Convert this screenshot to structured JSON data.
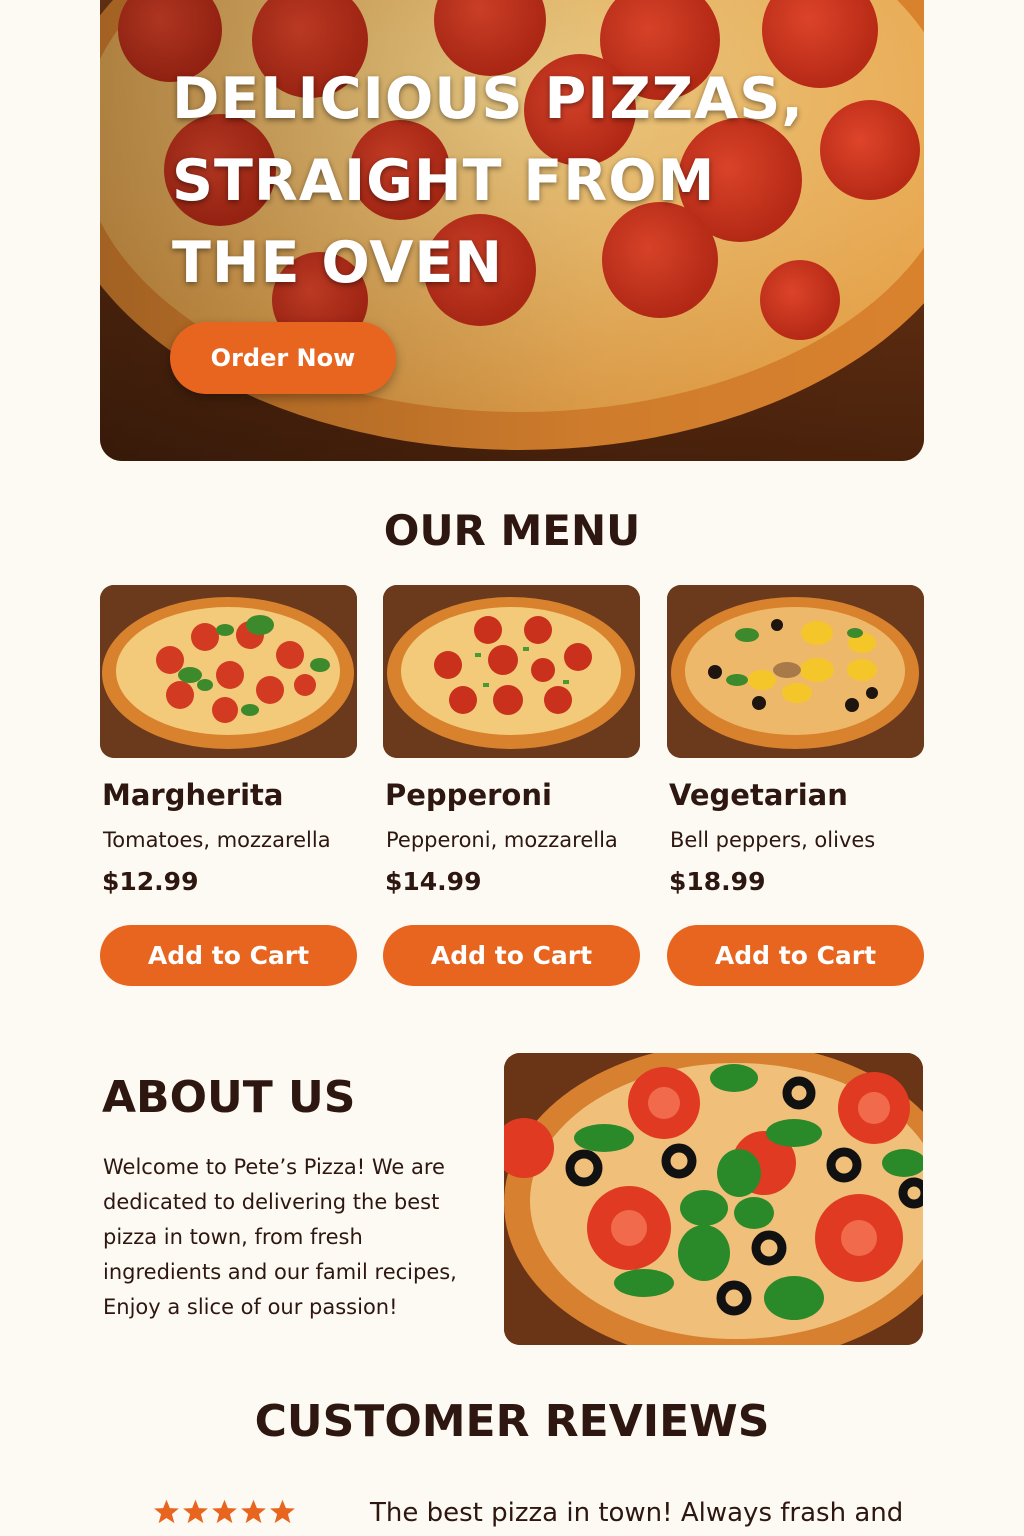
{
  "hero": {
    "title_lines": [
      "DELICIOUS PIZZAS,",
      "STRAIGHT FROM",
      "THE OVEN"
    ],
    "cta_label": "Order Now"
  },
  "menu": {
    "title": "OUR MENU",
    "items": [
      {
        "name": "Margherita",
        "description": "Tomatoes, mozzarella",
        "price": "$12.99",
        "button_label": "Add to Cart"
      },
      {
        "name": "Pepperoni",
        "description": "Pepperoni, mozzarella",
        "price": "$14.99",
        "button_label": "Add to Cart"
      },
      {
        "name": "Vegetarian",
        "description": "Bell peppers, olives",
        "price": "$18.99",
        "button_label": "Add to Cart"
      }
    ]
  },
  "about": {
    "title": "ABOUT US",
    "text": "Welcome to Pete’s Pizza! We are dedicated to delivering the best pizza in town, from fresh ingredients and our famil recipes, Enjoy a slice of our passion!"
  },
  "reviews": {
    "title": "CUSTOMER REVIEWS",
    "items": [
      {
        "rating": 5,
        "text": "The best pizza in town! Always frash and"
      }
    ]
  },
  "colors": {
    "accent": "#e8651f",
    "text": "#2d1710",
    "background": "#fdfaf3"
  }
}
